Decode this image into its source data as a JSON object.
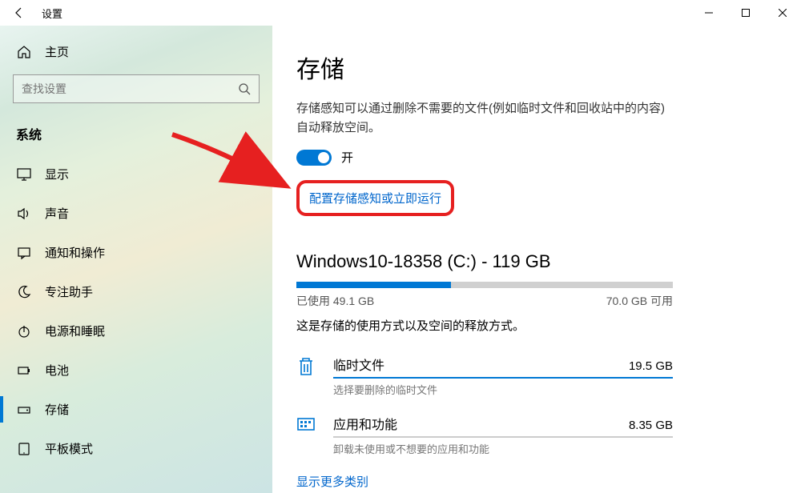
{
  "window": {
    "title": "设置",
    "controls": {
      "min": "–",
      "max": "□",
      "close": "×"
    }
  },
  "sidebar": {
    "home": "主页",
    "search_placeholder": "查找设置",
    "section": "系统",
    "items": [
      {
        "id": "display",
        "label": "显示",
        "icon": "monitor"
      },
      {
        "id": "sound",
        "label": "声音",
        "icon": "speaker"
      },
      {
        "id": "notifications",
        "label": "通知和操作",
        "icon": "message"
      },
      {
        "id": "focus",
        "label": "专注助手",
        "icon": "moon"
      },
      {
        "id": "power",
        "label": "电源和睡眠",
        "icon": "power"
      },
      {
        "id": "battery",
        "label": "电池",
        "icon": "battery"
      },
      {
        "id": "storage",
        "label": "存储",
        "icon": "drive",
        "selected": true
      },
      {
        "id": "tablet",
        "label": "平板模式",
        "icon": "tablet"
      }
    ]
  },
  "content": {
    "title": "存储",
    "description": "存储感知可以通过删除不需要的文件(例如临时文件和回收站中的内容)自动释放空间。",
    "toggle_state": "开",
    "config_link": "配置存储感知或立即运行",
    "drive": {
      "title": "Windows10-18358 (C:) - 119 GB",
      "used_label": "已使用",
      "used_value": "49.1 GB",
      "free_label": "可用",
      "free_value": "70.0 GB",
      "used_percent": 41,
      "description": "这是存储的使用方式以及空间的释放方式。"
    },
    "categories": [
      {
        "name": "临时文件",
        "size": "19.5 GB",
        "sub": "选择要删除的临时文件",
        "icon": "trash"
      },
      {
        "name": "应用和功能",
        "size": "8.35 GB",
        "sub": "卸载未使用或不想要的应用和功能",
        "icon": "apps"
      }
    ],
    "more_link": "显示更多类别"
  }
}
